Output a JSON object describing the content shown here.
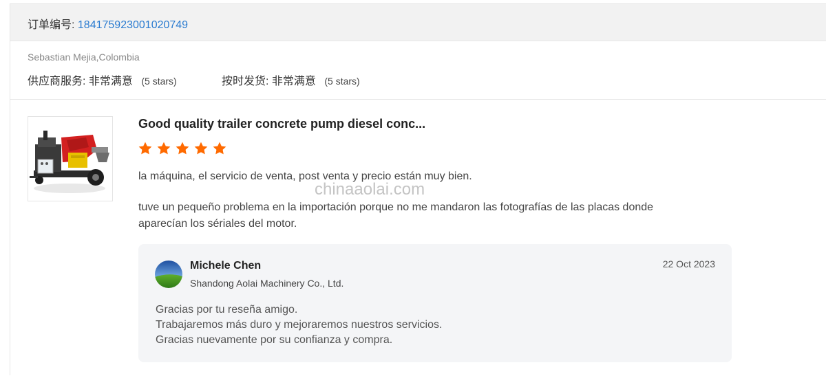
{
  "order": {
    "label": "订单编号:",
    "number": "184175923001020749"
  },
  "buyer": {
    "name_location": "Sebastian Mejia,Colombia",
    "ratings": [
      {
        "label": "供应商服务:",
        "value": "非常满意",
        "stars_note": "(5 stars)"
      },
      {
        "label": "按时发货:",
        "value": "非常满意",
        "stars_note": "(5 stars)"
      }
    ]
  },
  "review": {
    "product_title": "Good quality trailer concrete pump diesel conc...",
    "stars": 5,
    "star_color": "#ff6a00",
    "line1": "la máquina, el servicio de venta, post venta  y precio están muy bien.",
    "line2": "tuve un pequeño problema en la importación porque no me mandaron las fotografías de las placas donde",
    "line3": "aparecían los sériales del motor.",
    "watermark": "chinaaolai.com"
  },
  "reply": {
    "name": "Michele Chen",
    "company": "Shandong Aolai Machinery Co., Ltd.",
    "date": "22 Oct 2023",
    "line1": "Gracias por tu reseña amigo.",
    "line2": "Trabajaremos más duro y mejoraremos nuestros servicios.",
    "line3": "Gracias nuevamente por su confianza y compra."
  },
  "colors": {
    "link": "#2a7bd0",
    "header_bg": "#f2f2f2",
    "reply_bg": "#f4f5f7"
  }
}
